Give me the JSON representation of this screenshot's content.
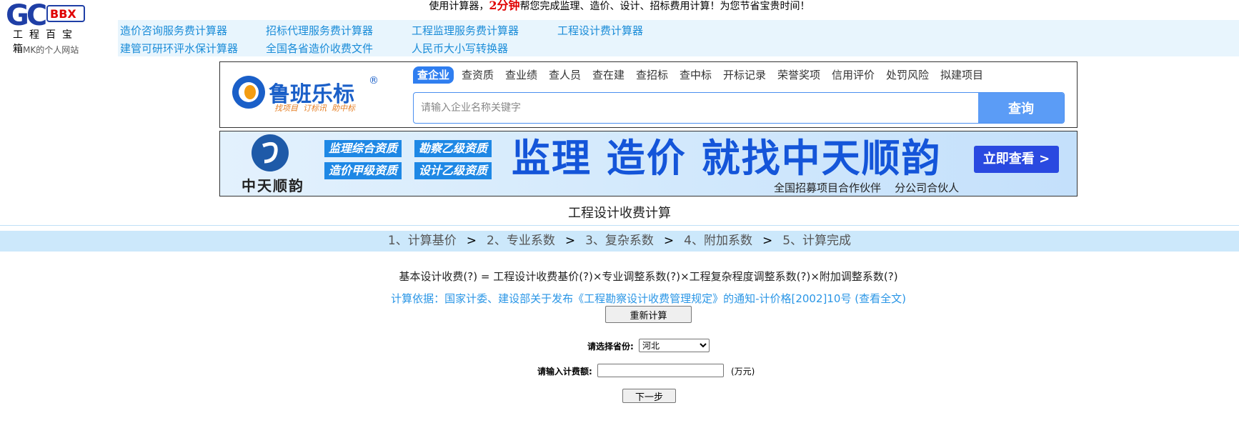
{
  "slogan": {
    "before": "使用计算器，",
    "highlight": "2分钟",
    "after": "帮您完成监理、造价、设计、招标费用计算！为您节省宝贵时间！"
  },
  "logo": {
    "mark": "GC",
    "badge": "BBX",
    "subtitle": "工程百宝箱",
    "site": "MK的个人网站"
  },
  "nav": {
    "links": [
      "造价咨询服务费计算器",
      "招标代理服务费计算器",
      "工程监理服务费计算器",
      "工程设计费计算器",
      "建管可研环评水保计算器",
      "全国各省造价收费文件",
      "人民币大小写转换器"
    ]
  },
  "luban": {
    "brand": "鲁班乐标",
    "reg": "®",
    "tagline": "找项目  订标讯  助中标",
    "tabs": [
      "查企业",
      "查资质",
      "查业绩",
      "查人员",
      "查在建",
      "查招标",
      "查中标",
      "开标记录",
      "荣誉奖项",
      "信用评价",
      "处罚风险",
      "拟建项目"
    ],
    "search_placeholder": "请输入企业名称关键字",
    "search_button": "查询"
  },
  "banner": {
    "company": "中天顺韵",
    "badges": [
      "监理综合资质",
      "勘察乙级资质",
      "造价甲级资质",
      "设计乙级资质"
    ],
    "headline": "监理 造价 就找中天顺韵",
    "cta": "立即查看 >",
    "subline": "全国招募项目合作伙伴    分公司合伙人"
  },
  "page_title": "工程设计收费计算",
  "steps": [
    "1、计算基价",
    "2、专业系数",
    "3、复杂系数",
    "4、附加系数",
    "5、计算完成"
  ],
  "step_sep": ">",
  "formula": "基本设计收费(?) =  工程设计收费基价(?)×专业调整系数(?)×工程复杂程度调整系数(?)×附加调整系数(?)",
  "basis": "计算依据：国家计委、建设部关于发布《工程勘察设计收费管理规定》的通知-计价格[2002]10号 (查看全文)",
  "recalc_button": "重新计算",
  "form": {
    "province_label": "请选择省份:",
    "province_value": "河北",
    "fee_label": "请输入计费额:",
    "fee_value": "",
    "fee_unit": "(万元)",
    "next_button": "下一步"
  },
  "colors": {
    "link": "#1a8cd8",
    "accent_blue": "#2f7ef0",
    "steps_bg": "#cce8fb",
    "nav_bg": "#e8f5fd",
    "highlight_red": "#e00000"
  }
}
